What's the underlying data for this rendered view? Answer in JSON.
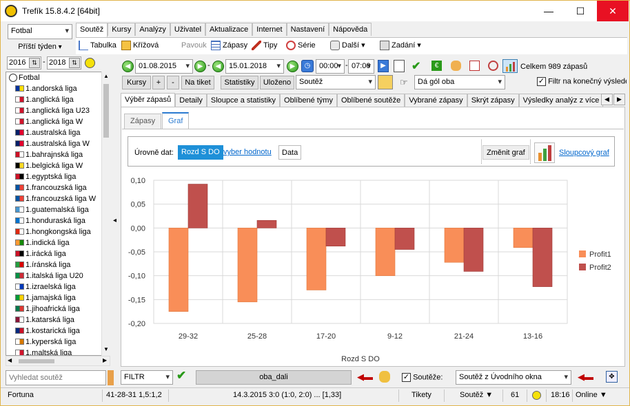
{
  "window": {
    "title": "Trefík 15.8.4.2 [64bit]",
    "min_glyph": "—",
    "max_glyph": "☐",
    "close_glyph": "✕"
  },
  "sidebar": {
    "sport": "Fotbal",
    "period": "Příští týden",
    "year_from": "2016",
    "year_to": "2018",
    "dash": "-",
    "root": "Fotbal",
    "leagues": [
      {
        "name": "1.andorská liga",
        "c1": "#0032a0",
        "c2": "#fedf00"
      },
      {
        "name": "1.anglická liga",
        "c1": "#ffffff",
        "c2": "#cf142b"
      },
      {
        "name": "1.anglická liga U23",
        "c1": "#ffffff",
        "c2": "#cf142b"
      },
      {
        "name": "1.anglická liga W",
        "c1": "#ffffff",
        "c2": "#cf142b"
      },
      {
        "name": "1.australská liga",
        "c1": "#012169",
        "c2": "#e4002b"
      },
      {
        "name": "1.australská liga W",
        "c1": "#012169",
        "c2": "#e4002b"
      },
      {
        "name": "1.bahrajnská liga",
        "c1": "#ce1126",
        "c2": "#ffffff"
      },
      {
        "name": "1.belgická liga W",
        "c1": "#000000",
        "c2": "#fdda24"
      },
      {
        "name": "1.egyptská liga",
        "c1": "#ce1126",
        "c2": "#000000"
      },
      {
        "name": "1.francouzská liga",
        "c1": "#0055a4",
        "c2": "#ef4135"
      },
      {
        "name": "1.francouzská liga W",
        "c1": "#0055a4",
        "c2": "#ef4135"
      },
      {
        "name": "1.guatemalská liga",
        "c1": "#4997d0",
        "c2": "#ffffff"
      },
      {
        "name": "1.honduraská liga",
        "c1": "#0073cf",
        "c2": "#ffffff"
      },
      {
        "name": "1.hongkongská liga",
        "c1": "#de2910",
        "c2": "#ffffff"
      },
      {
        "name": "1.indická liga",
        "c1": "#ff9933",
        "c2": "#138808"
      },
      {
        "name": "1.irácká liga",
        "c1": "#ce1126",
        "c2": "#000000"
      },
      {
        "name": "1.íránská liga",
        "c1": "#239f40",
        "c2": "#da0000"
      },
      {
        "name": "1.italská liga U20",
        "c1": "#009246",
        "c2": "#ce2b37"
      },
      {
        "name": "1.izraelská liga",
        "c1": "#ffffff",
        "c2": "#0038b8"
      },
      {
        "name": "1.jamajská liga",
        "c1": "#009b3a",
        "c2": "#fed100"
      },
      {
        "name": "1.jihoafrická liga",
        "c1": "#007a4d",
        "c2": "#de3831"
      },
      {
        "name": "1.katarská liga",
        "c1": "#8a1538",
        "c2": "#ffffff"
      },
      {
        "name": "1.kostarická liga",
        "c1": "#002b7f",
        "c2": "#ce1126"
      },
      {
        "name": "1.kyperská liga",
        "c1": "#ffffff",
        "c2": "#d57800"
      },
      {
        "name": "1.maltská liga",
        "c1": "#ffffff",
        "c2": "#cf142b"
      }
    ],
    "search_placeholder": "Vyhledat soutěž"
  },
  "menu_tabs": [
    "Soutěž",
    "Kursy",
    "Analýzy",
    "Uživatel",
    "Aktualizace",
    "Internet",
    "Nastavení",
    "Nápověda"
  ],
  "toolbar": {
    "tabulka": "Tabulka",
    "krizova": "Křížová",
    "pavouk": "Pavouk",
    "zapasy": "Zápasy",
    "tipy": "Tipy",
    "serie": "Série",
    "dalsi": "Další",
    "zadani": "Zadání"
  },
  "filters": {
    "date_from": "01.08.2015",
    "date_to": "15.01.2018",
    "dash": "-",
    "time_from": "00:00",
    "time_to": "07:00",
    "total": "Celkem 989 zápasů",
    "kursy": "Kursy",
    "plus": "+",
    "minus": "-",
    "na_tiket": "Na tiket",
    "statistiky": "Statistiky",
    "ulozeno": "Uloženo",
    "competition": "Soutěž",
    "condition": "Dá gól oba",
    "final_filter_label": "Filtr na konečný výsledek"
  },
  "content_tabs": [
    "Výběr zápasů",
    "Detaily",
    "Sloupce a statistiky",
    "Oblíbené týmy",
    "Oblíbené soutěže",
    "Vybrané zápasy",
    "Skrýt zápasy",
    "Výsledky analýz z více"
  ],
  "sub_tabs": [
    "Zápasy",
    "Graf"
  ],
  "graph_bar": {
    "levels_label": "Úrovně dat:",
    "level_active": "Rozd S DO",
    "level_pick": "vyber hodnotu",
    "level_data": "Data",
    "change": "Změnit graf",
    "chart_kind": "Sloupcový graf"
  },
  "chart_data": {
    "type": "bar",
    "categories": [
      "29-32",
      "25-28",
      "17-20",
      "9-12",
      "21-24",
      "13-16"
    ],
    "series": [
      {
        "name": "Profit1",
        "color": "#f98e58",
        "values": [
          -0.175,
          -0.155,
          -0.13,
          -0.1,
          -0.072,
          -0.041
        ]
      },
      {
        "name": "Profit2",
        "color": "#c0504d",
        "values": [
          0.092,
          0.016,
          -0.038,
          -0.045,
          -0.091,
          -0.123
        ]
      }
    ],
    "xlabel": "Rozd S DO",
    "ylim": [
      -0.2,
      0.1
    ],
    "yticks": [
      "0,10",
      "0,05",
      "0,00",
      "-0,05",
      "-0,10",
      "-0,15",
      "-0,20"
    ],
    "grid": true,
    "legend": "right"
  },
  "bottom_bar": {
    "filter": "FILTR",
    "current": "oba_dali",
    "competitions_label": "Soutěže:",
    "competitions_value": "Soutěž z Úvodního okna"
  },
  "status": {
    "bookmaker": "Fortuna",
    "record": "41-28-31  1,5:1,2",
    "last_match": "14.3.2015 3:0 (1:0, 2:0) ... [1,33]",
    "tikety": "Tikety",
    "soutez": "Soutěž ▼",
    "count": "61",
    "time": "18:16",
    "online": "Online ▼"
  }
}
